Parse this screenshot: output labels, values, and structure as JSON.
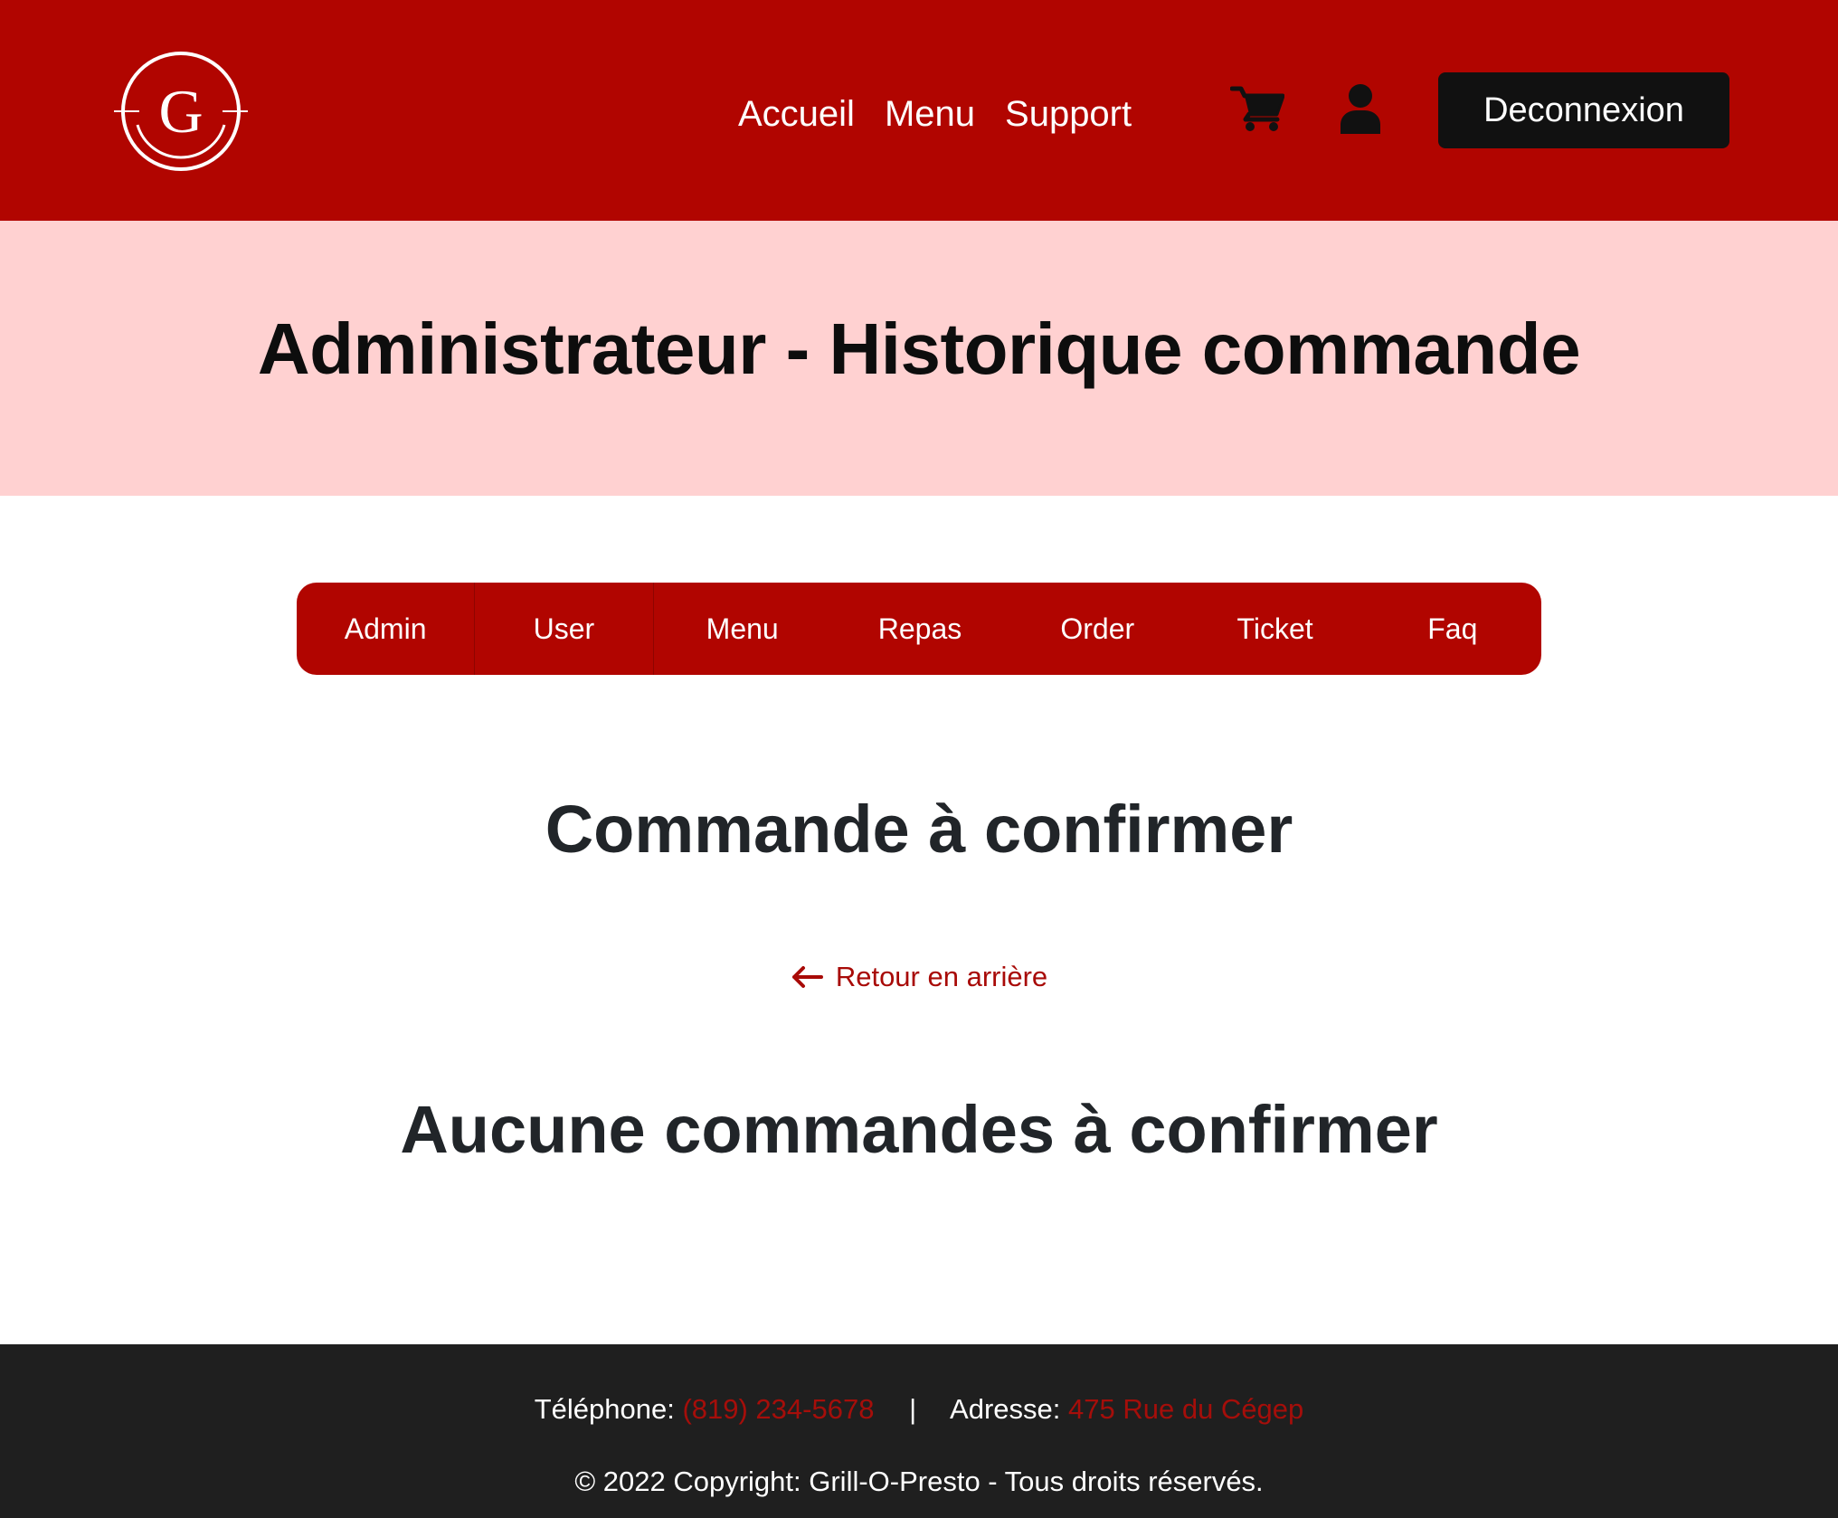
{
  "header": {
    "logo_letter": "G",
    "nav": [
      "Accueil",
      "Menu",
      "Support"
    ],
    "icons": [
      "cart-icon",
      "user-icon"
    ],
    "logout_label": "Deconnexion"
  },
  "page_title": "Administrateur - Historique commande",
  "admin_tabs": [
    "Admin",
    "User",
    "Menu",
    "Repas",
    "Order",
    "Ticket",
    "Faq"
  ],
  "main": {
    "section_title": "Commande à confirmer",
    "back_label": "Retour en arrière",
    "empty_message": "Aucune commandes à confirmer"
  },
  "footer": {
    "phone_label": "Téléphone:",
    "phone_value": "(819) 234-5678",
    "separator": "|",
    "address_label": "Adresse:",
    "address_value": "475 Rue du Cégep",
    "copyright": "© 2022 Copyright: Grill-O-Presto - Tous droits réservés."
  },
  "colors": {
    "brand_red": "#b10500",
    "title_band": "#ffd1d1",
    "footer_bg": "#1f1f1f",
    "link_red": "#a80a07"
  }
}
